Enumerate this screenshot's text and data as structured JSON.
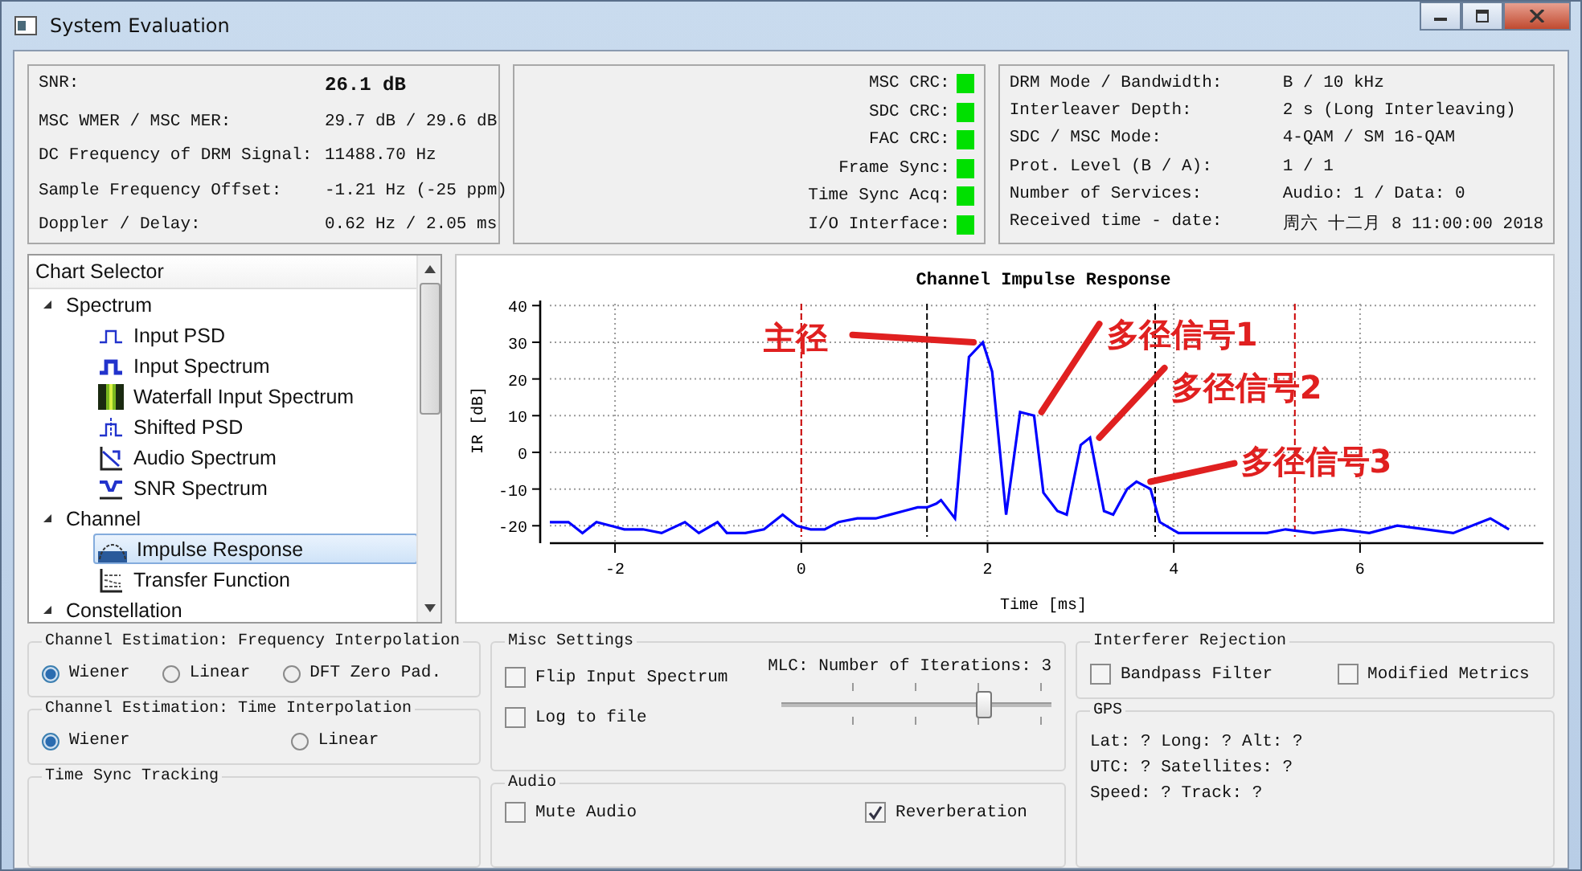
{
  "window": {
    "title": "System Evaluation"
  },
  "measurements": [
    {
      "label": "SNR:",
      "value": "26.1 dB",
      "bold": true
    },
    {
      "label": "MSC WMER / MSC MER:",
      "value": "29.7 dB / 29.6 dB",
      "bold": false
    },
    {
      "label": "DC Frequency of DRM Signal:",
      "value": "11488.70 Hz",
      "bold": false
    },
    {
      "label": "Sample Frequency Offset:",
      "value": "-1.21 Hz (-25 ppm)",
      "bold": false
    },
    {
      "label": "Doppler / Delay:",
      "value": "0.62 Hz / 2.05 ms",
      "bold": false
    }
  ],
  "status_leds": [
    {
      "label": "MSC CRC:",
      "ok": true
    },
    {
      "label": "SDC CRC:",
      "ok": true
    },
    {
      "label": "FAC CRC:",
      "ok": true
    },
    {
      "label": "Frame Sync:",
      "ok": true
    },
    {
      "label": "Time Sync Acq:",
      "ok": true
    },
    {
      "label": "I/O Interface:",
      "ok": true
    }
  ],
  "signal_info": [
    {
      "label": "DRM Mode / Bandwidth:",
      "value": "B / 10 kHz"
    },
    {
      "label": "Interleaver Depth:",
      "value": "2 s (Long Interleaving)"
    },
    {
      "label": "SDC / MSC Mode:",
      "value": "4-QAM / SM 16-QAM"
    },
    {
      "label": "Prot. Level (B / A):",
      "value": "1 / 1"
    },
    {
      "label": "Number of Services:",
      "value": "Audio: 1 / Data: 0"
    },
    {
      "label": "Received time - date:",
      "value": "周六 十二月 8 11:00:00 2018"
    }
  ],
  "chart_selector": {
    "header": "Chart Selector",
    "items": [
      {
        "label": "Spectrum",
        "expanded": true,
        "children": [
          {
            "label": "Input PSD",
            "selected": false
          },
          {
            "label": "Input Spectrum",
            "selected": false
          },
          {
            "label": "Waterfall Input Spectrum",
            "selected": false
          },
          {
            "label": "Shifted PSD",
            "selected": false
          },
          {
            "label": "Audio Spectrum",
            "selected": false
          },
          {
            "label": "SNR Spectrum",
            "selected": false
          }
        ]
      },
      {
        "label": "Channel",
        "expanded": true,
        "children": [
          {
            "label": "Impulse Response",
            "selected": true
          },
          {
            "label": "Transfer Function",
            "selected": false
          }
        ]
      },
      {
        "label": "Constellation",
        "expanded": true
      }
    ]
  },
  "chart": {
    "chart_data": {
      "type": "line",
      "title": "Channel Impulse Response",
      "xlabel": "Time [ms]",
      "ylabel": "IR [dB]",
      "x": [
        -2.7,
        -2.5,
        -2.35,
        -2.2,
        -2.05,
        -1.9,
        -1.7,
        -1.5,
        -1.25,
        -1.1,
        -0.9,
        -0.8,
        -0.6,
        -0.4,
        -0.2,
        -0.05,
        0.1,
        0.25,
        0.4,
        0.6,
        0.8,
        0.95,
        1.1,
        1.25,
        1.35,
        1.45,
        1.5,
        1.65,
        1.8,
        1.95,
        2.05,
        2.2,
        2.35,
        2.5,
        2.6,
        2.75,
        2.85,
        3.0,
        3.1,
        3.25,
        3.35,
        3.5,
        3.6,
        3.75,
        3.85,
        4.05,
        4.3,
        4.6,
        5.0,
        5.2,
        5.5,
        5.8,
        6.1,
        6.4,
        7.0,
        7.4,
        7.6
      ],
      "series": [
        {
          "color": "#0000ff",
          "values": [
            -19,
            -19,
            -22,
            -19,
            -20,
            -21,
            -21,
            -22,
            -19,
            -22,
            -19,
            -22,
            -22,
            -21,
            -17,
            -20,
            -21,
            -21,
            -19,
            -18,
            -18,
            -17,
            -16,
            -15,
            -15,
            -14,
            -13,
            -18,
            26,
            30,
            22,
            -17,
            11,
            10,
            -11,
            -16,
            -17,
            2,
            4,
            -16,
            -17,
            -10,
            -8,
            -10,
            -19,
            -22,
            -22,
            -22,
            -22,
            -21,
            -22,
            -21,
            -22,
            -20,
            -22,
            -18,
            -21
          ]
        }
      ],
      "xlim": [
        -2.7,
        7.9
      ],
      "ylim": [
        -23,
        40.5
      ],
      "xticks": [
        -2,
        0,
        2,
        4,
        6
      ],
      "yticks": [
        -20,
        -10,
        0,
        10,
        20,
        30,
        40
      ],
      "grid": true,
      "ref_lines": [
        {
          "axis": "x",
          "value": 0,
          "color": "#cc0000"
        },
        {
          "axis": "x",
          "value": 1.35,
          "color": "#000000"
        },
        {
          "axis": "x",
          "value": 3.8,
          "color": "#000000"
        },
        {
          "axis": "x",
          "value": 5.3,
          "color": "#cc0000"
        }
      ],
      "annotations": [
        "主径",
        "多径信号1",
        "多径信号2",
        "多径信号3"
      ]
    }
  },
  "freq_interpolation": {
    "title": "Channel Estimation: Frequency Interpolation",
    "options": [
      {
        "label": "Wiener",
        "selected": true
      },
      {
        "label": "Linear",
        "selected": false
      },
      {
        "label": "DFT Zero Pad.",
        "selected": false
      }
    ]
  },
  "time_interpolation": {
    "title": "Channel Estimation: Time Interpolation",
    "options": [
      {
        "label": "Wiener",
        "selected": true
      },
      {
        "label": "Linear",
        "selected": false
      }
    ]
  },
  "time_sync_tracking": {
    "title": "Time Sync Tracking"
  },
  "misc_settings": {
    "title": "Misc Settings",
    "checkboxes": [
      {
        "label": "Flip Input Spectrum",
        "checked": false
      },
      {
        "label": "Log to file",
        "checked": false
      }
    ],
    "slider": {
      "label": "MLC: Number of Iterations: 3",
      "level": 0.75
    }
  },
  "audio": {
    "title": "Audio",
    "checkboxes": [
      {
        "label": "Mute Audio",
        "checked": false
      },
      {
        "label": "Reverberation",
        "checked": true
      }
    ]
  },
  "interferer_rejection": {
    "title": "Interferer Rejection",
    "checkboxes": [
      {
        "label": "Bandpass Filter",
        "checked": false
      },
      {
        "label": "Modified Metrics",
        "checked": false
      }
    ]
  },
  "gps": {
    "title": "GPS",
    "lines": [
      "Lat: ?  Long: ?  Alt: ?",
      "UTC: ?  Satellites: ?",
      "Speed: ?  Track: ?"
    ]
  }
}
